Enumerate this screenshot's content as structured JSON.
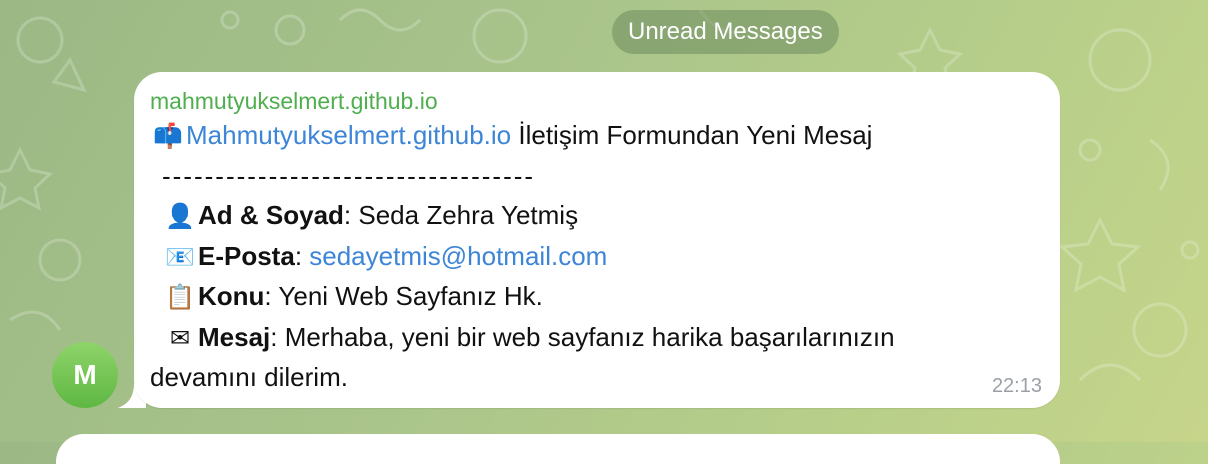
{
  "divider": {
    "unread_label": "Unread Messages"
  },
  "message": {
    "sender": "mahmutyukselmert.github.io",
    "avatar_letter": "M",
    "title_link": "Mahmutyukselmert.github.io",
    "title_rest": " İletişim Formundan Yeni Mesaj",
    "separator": "-----------------------------------",
    "name_label": "Ad & Soyad",
    "name_value": " Seda Zehra Yetmiş",
    "email_label": "E-Posta",
    "email_value": "sedayetmis@hotmail.com",
    "subject_label": "Konu",
    "subject_value": " Yeni Web Sayfanız Hk.",
    "message_label": "Mesaj",
    "message_value_line1": " Merhaba, yeni bir web sayfanız harika başarılarınızın",
    "message_value_line2": "devamını dilerim.",
    "time": "22:13"
  },
  "icons": {
    "title": "mailbox-icon",
    "name": "user-icon",
    "email": "envelope-icon",
    "subject": "clipboard-icon",
    "message": "letter-icon"
  },
  "colors": {
    "sender": "#4fae4e",
    "link": "#3d85d6",
    "avatar": "#6cc24a"
  }
}
